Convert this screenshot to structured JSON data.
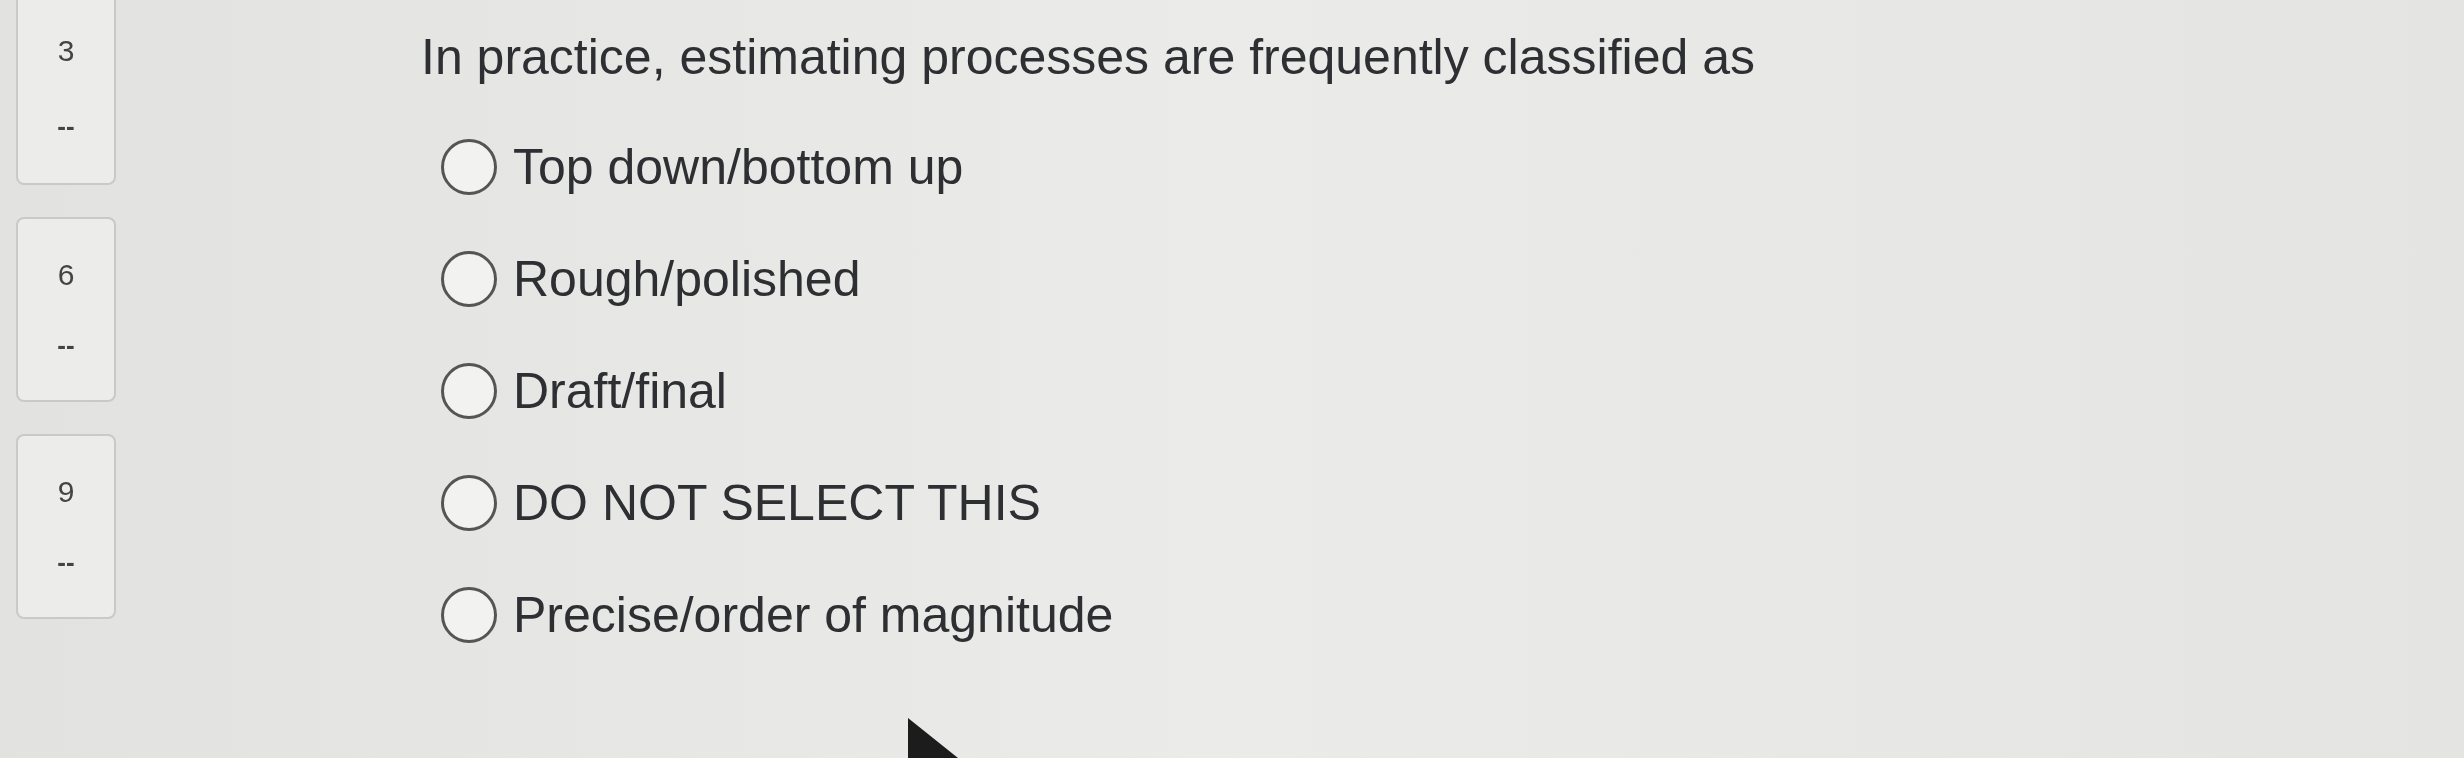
{
  "question_nav": [
    {
      "number": "3",
      "status": "--"
    },
    {
      "number": "6",
      "status": "--"
    },
    {
      "number": "9",
      "status": "--"
    }
  ],
  "question": {
    "text": "In practice, estimating processes are frequently classified as"
  },
  "options": [
    {
      "label": "Top down/bottom up",
      "selected": false
    },
    {
      "label": "Rough/polished",
      "selected": false
    },
    {
      "label": "Draft/final",
      "selected": false
    },
    {
      "label": "DO NOT SELECT THIS",
      "selected": false
    },
    {
      "label": "Precise/order of magnitude",
      "selected": false
    }
  ]
}
